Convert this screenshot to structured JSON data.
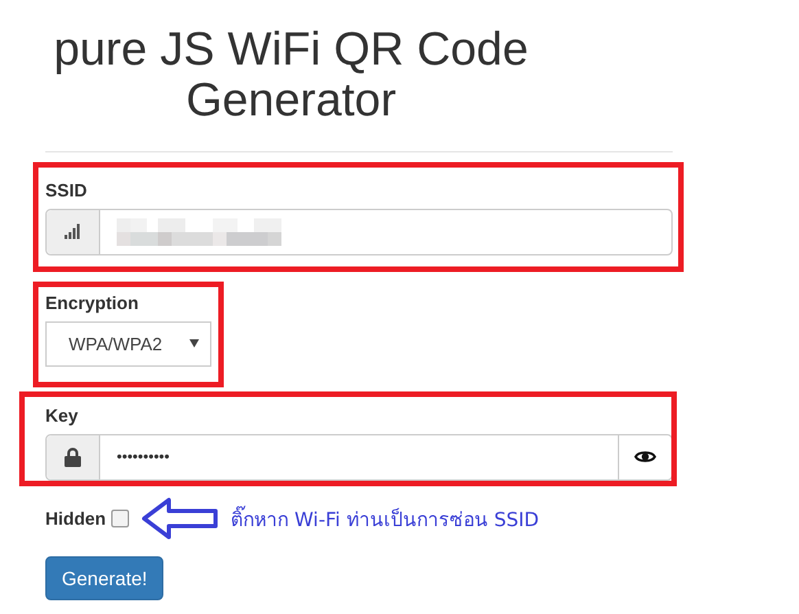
{
  "title": "pure JS WiFi QR Code Generator",
  "form": {
    "ssid": {
      "label": "SSID"
    },
    "encryption": {
      "label": "Encryption",
      "value": "WPA/WPA2"
    },
    "key": {
      "label": "Key",
      "value": "••••••••••"
    },
    "hidden": {
      "label": "Hidden",
      "checked": false
    },
    "button": "Generate!"
  },
  "annotation": {
    "note": "ติ๊กหาก Wi-Fi ท่านเป็นการซ่อน SSID"
  }
}
